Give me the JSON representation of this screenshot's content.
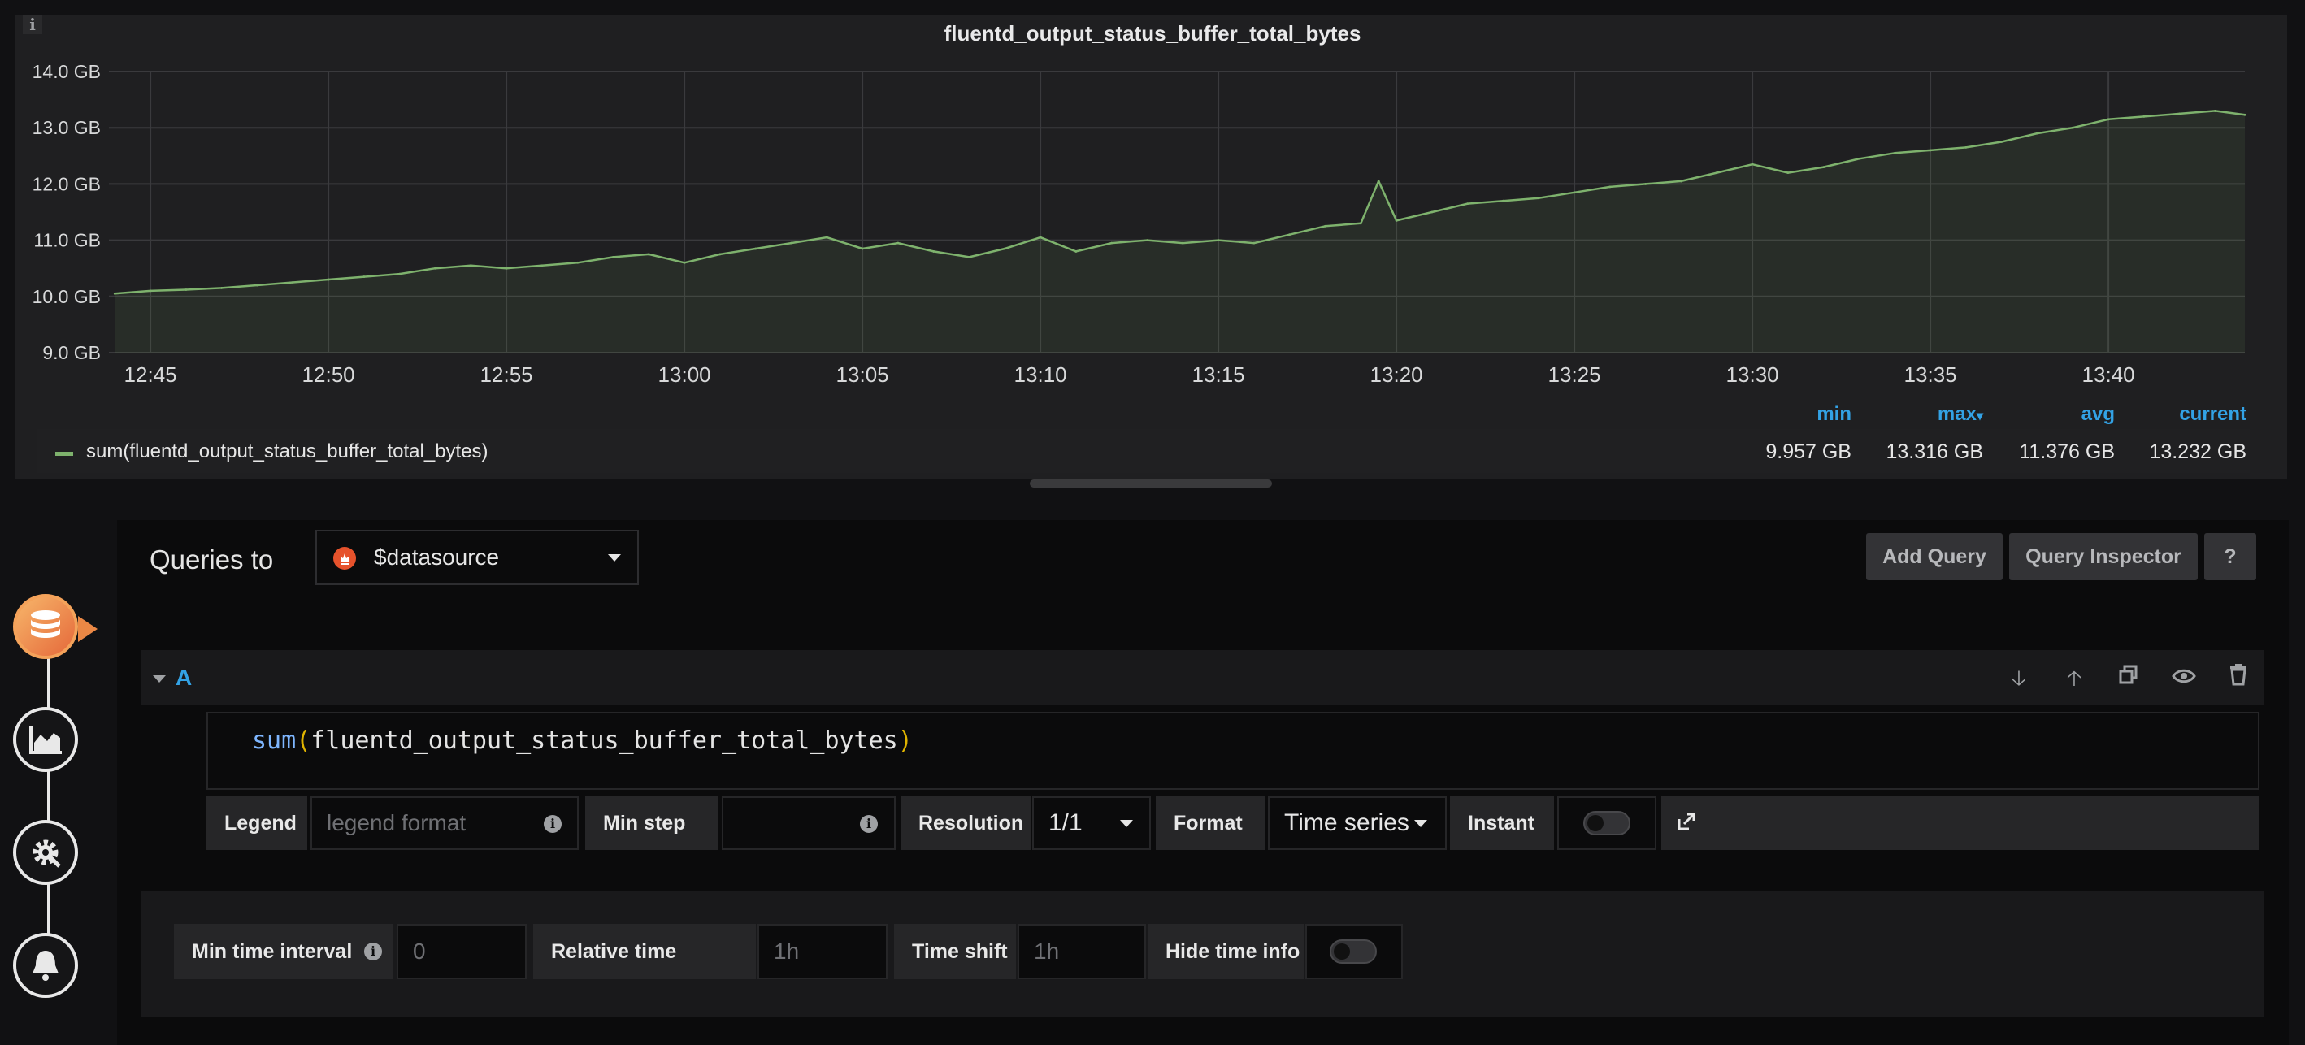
{
  "panel": {
    "title": "fluentd_output_status_buffer_total_bytes",
    "info_icon": "i"
  },
  "chart_data": {
    "type": "area",
    "title": "fluentd_output_status_buffer_total_bytes",
    "xlabel": "",
    "ylabel": "",
    "y_ticks": [
      "14.0 GB",
      "13.0 GB",
      "12.0 GB",
      "11.0 GB",
      "10.0 GB",
      "9.0 GB"
    ],
    "x_ticks": [
      "12:45",
      "12:50",
      "12:55",
      "13:00",
      "13:05",
      "13:10",
      "13:15",
      "13:20",
      "13:25",
      "13:30",
      "13:35",
      "13:40"
    ],
    "ylim": [
      9.0,
      14.0
    ],
    "x_range": [
      "12:43:50",
      "13:43:50"
    ],
    "grid": true,
    "series": [
      {
        "name": "sum(fluentd_output_status_buffer_total_bytes)",
        "color": "#7eb26d",
        "x": [
          "12:44",
          "12:45",
          "12:46",
          "12:47",
          "12:48",
          "12:49",
          "12:50",
          "12:51",
          "12:52",
          "12:53",
          "12:54",
          "12:55",
          "12:56",
          "12:57",
          "12:58",
          "12:59",
          "13:00",
          "13:01",
          "13:02",
          "13:03",
          "13:04",
          "13:05",
          "13:06",
          "13:07",
          "13:08",
          "13:09",
          "13:10",
          "13:11",
          "13:12",
          "13:13",
          "13:14",
          "13:15",
          "13:16",
          "13:17",
          "13:18",
          "13:19",
          "13:19:30",
          "13:20",
          "13:21",
          "13:22",
          "13:23",
          "13:24",
          "13:25",
          "13:26",
          "13:27",
          "13:28",
          "13:29",
          "13:30",
          "13:31",
          "13:32",
          "13:33",
          "13:34",
          "13:35",
          "13:36",
          "13:37",
          "13:38",
          "13:39",
          "13:40",
          "13:41",
          "13:42",
          "13:43",
          "13:43:50"
        ],
        "values": [
          10.05,
          10.1,
          10.12,
          10.15,
          10.2,
          10.25,
          10.3,
          10.35,
          10.4,
          10.5,
          10.55,
          10.5,
          10.55,
          10.6,
          10.7,
          10.75,
          10.6,
          10.75,
          10.85,
          10.95,
          11.05,
          10.85,
          10.95,
          10.8,
          10.7,
          10.85,
          11.05,
          10.8,
          10.95,
          11.0,
          10.95,
          11.0,
          10.95,
          11.1,
          11.25,
          11.3,
          12.05,
          11.35,
          11.5,
          11.65,
          11.7,
          11.75,
          11.85,
          11.95,
          12.0,
          12.05,
          12.2,
          12.35,
          12.2,
          12.3,
          12.45,
          12.55,
          12.6,
          12.65,
          12.75,
          12.9,
          13.0,
          13.15,
          13.2,
          13.25,
          13.3,
          13.23
        ]
      }
    ],
    "legend": {
      "columns": [
        "min",
        "max",
        "avg",
        "current"
      ],
      "sort_indicator": "max",
      "values": {
        "min": "9.957 GB",
        "max": "13.316 GB",
        "avg": "11.376 GB",
        "current": "13.232 GB"
      }
    }
  },
  "sidebar": {
    "items": [
      {
        "name": "queries",
        "icon": "database-icon",
        "active": true
      },
      {
        "name": "visualization",
        "icon": "area-chart-icon"
      },
      {
        "name": "general",
        "icon": "cog-icon"
      },
      {
        "name": "alert",
        "icon": "bell-icon"
      }
    ],
    "active_color": "#eb8845"
  },
  "editor": {
    "queries_to_label": "Queries to",
    "datasource": "$datasource",
    "add_query_label": "Add Query",
    "query_inspector_label": "Query Inspector",
    "help_label": "?"
  },
  "query": {
    "ref_id": "A",
    "expression_fn": "sum",
    "expression_open": "(",
    "expression_metric": "fluentd_output_status_buffer_total_bytes",
    "expression_close": ")",
    "legend_label": "Legend",
    "legend_placeholder": "legend format",
    "min_step_label": "Min step",
    "min_step_value": "",
    "resolution_label": "Resolution",
    "resolution_value": "1/1",
    "format_label": "Format",
    "format_value": "Time series",
    "instant_label": "Instant",
    "instant_enabled": false
  },
  "options": {
    "min_time_interval_label": "Min time interval",
    "min_time_interval_placeholder": "0",
    "relative_time_label": "Relative time",
    "relative_time_placeholder": "1h",
    "time_shift_label": "Time shift",
    "time_shift_placeholder": "1h",
    "hide_time_info_label": "Hide time info",
    "hide_time_info_enabled": false
  }
}
